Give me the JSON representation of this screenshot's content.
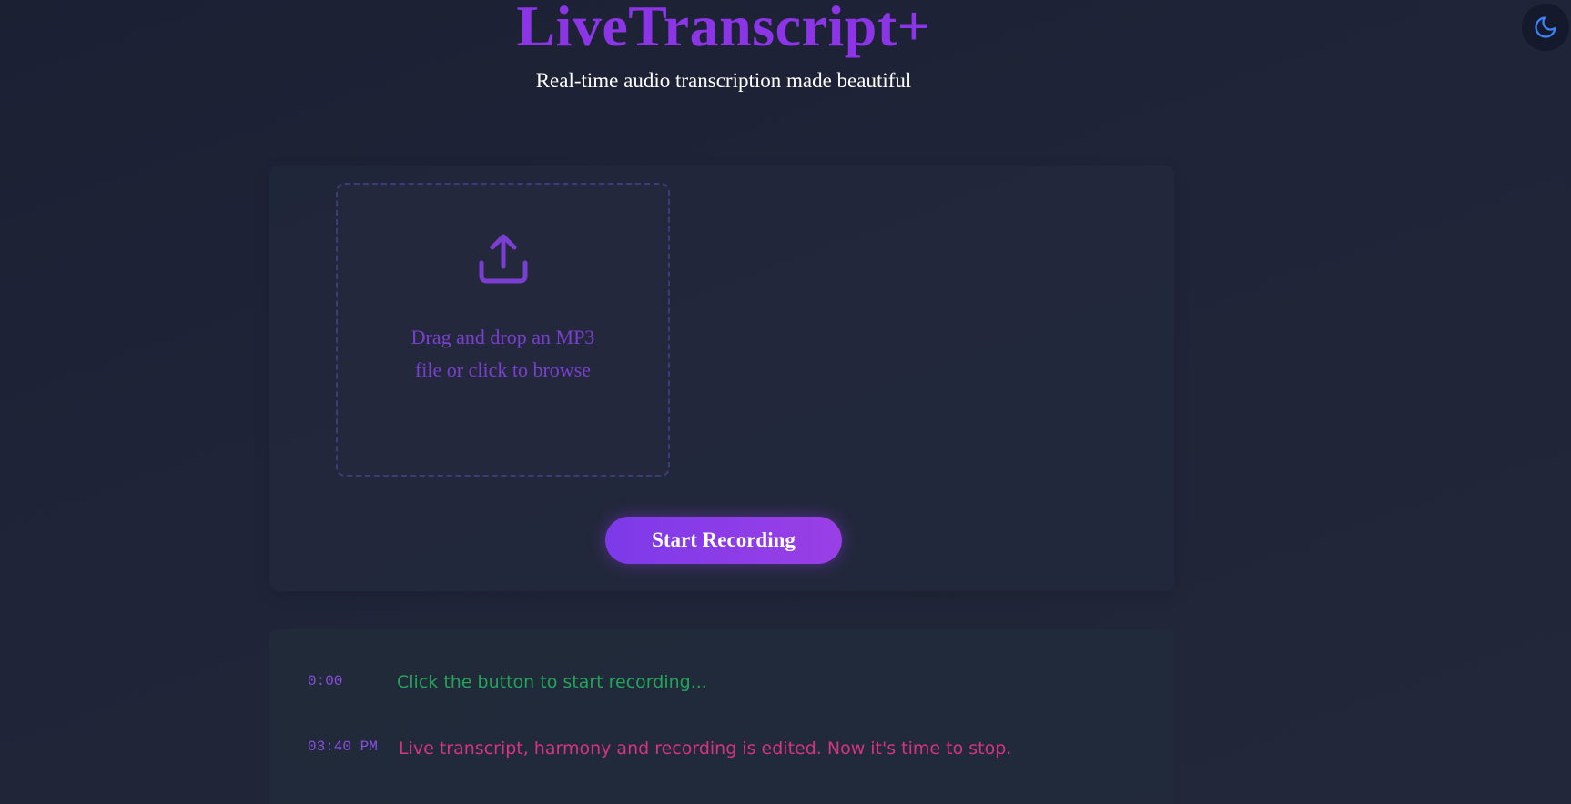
{
  "header": {
    "title": "LiveTranscript+",
    "subtitle": "Real-time audio transcription made beautiful"
  },
  "theme_toggle": {
    "icon": "moon-icon",
    "color": "#3b82f6"
  },
  "upload": {
    "icon": "upload-icon",
    "prompt": "Drag and drop an MP3 file or click to browse"
  },
  "recorder": {
    "button_label": "Start Recording"
  },
  "transcript": {
    "entries": [
      {
        "time": "0:00",
        "text": "Click the button to start recording...",
        "color": "#22a55a"
      },
      {
        "time": "03:40 PM",
        "text": "Live transcript, harmony and recording is edited. Now it's time to stop.",
        "color": "#d63384"
      }
    ]
  },
  "colors": {
    "accent": "#8b35e6",
    "background": "#1f2438"
  }
}
